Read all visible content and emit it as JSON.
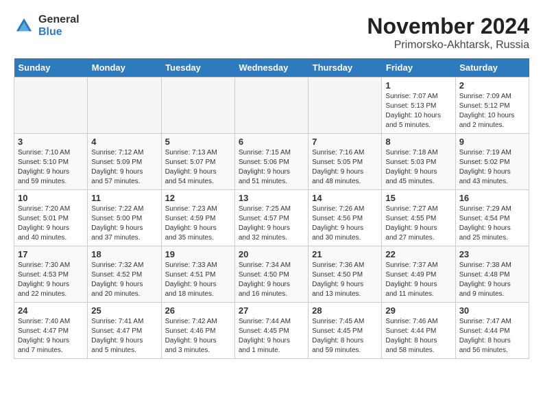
{
  "logo": {
    "general": "General",
    "blue": "Blue"
  },
  "header": {
    "month": "November 2024",
    "location": "Primorsko-Akhtarsk, Russia"
  },
  "weekdays": [
    "Sunday",
    "Monday",
    "Tuesday",
    "Wednesday",
    "Thursday",
    "Friday",
    "Saturday"
  ],
  "weeks": [
    [
      {
        "day": "",
        "info": ""
      },
      {
        "day": "",
        "info": ""
      },
      {
        "day": "",
        "info": ""
      },
      {
        "day": "",
        "info": ""
      },
      {
        "day": "",
        "info": ""
      },
      {
        "day": "1",
        "info": "Sunrise: 7:07 AM\nSunset: 5:13 PM\nDaylight: 10 hours\nand 5 minutes."
      },
      {
        "day": "2",
        "info": "Sunrise: 7:09 AM\nSunset: 5:12 PM\nDaylight: 10 hours\nand 2 minutes."
      }
    ],
    [
      {
        "day": "3",
        "info": "Sunrise: 7:10 AM\nSunset: 5:10 PM\nDaylight: 9 hours\nand 59 minutes."
      },
      {
        "day": "4",
        "info": "Sunrise: 7:12 AM\nSunset: 5:09 PM\nDaylight: 9 hours\nand 57 minutes."
      },
      {
        "day": "5",
        "info": "Sunrise: 7:13 AM\nSunset: 5:07 PM\nDaylight: 9 hours\nand 54 minutes."
      },
      {
        "day": "6",
        "info": "Sunrise: 7:15 AM\nSunset: 5:06 PM\nDaylight: 9 hours\nand 51 minutes."
      },
      {
        "day": "7",
        "info": "Sunrise: 7:16 AM\nSunset: 5:05 PM\nDaylight: 9 hours\nand 48 minutes."
      },
      {
        "day": "8",
        "info": "Sunrise: 7:18 AM\nSunset: 5:03 PM\nDaylight: 9 hours\nand 45 minutes."
      },
      {
        "day": "9",
        "info": "Sunrise: 7:19 AM\nSunset: 5:02 PM\nDaylight: 9 hours\nand 43 minutes."
      }
    ],
    [
      {
        "day": "10",
        "info": "Sunrise: 7:20 AM\nSunset: 5:01 PM\nDaylight: 9 hours\nand 40 minutes."
      },
      {
        "day": "11",
        "info": "Sunrise: 7:22 AM\nSunset: 5:00 PM\nDaylight: 9 hours\nand 37 minutes."
      },
      {
        "day": "12",
        "info": "Sunrise: 7:23 AM\nSunset: 4:59 PM\nDaylight: 9 hours\nand 35 minutes."
      },
      {
        "day": "13",
        "info": "Sunrise: 7:25 AM\nSunset: 4:57 PM\nDaylight: 9 hours\nand 32 minutes."
      },
      {
        "day": "14",
        "info": "Sunrise: 7:26 AM\nSunset: 4:56 PM\nDaylight: 9 hours\nand 30 minutes."
      },
      {
        "day": "15",
        "info": "Sunrise: 7:27 AM\nSunset: 4:55 PM\nDaylight: 9 hours\nand 27 minutes."
      },
      {
        "day": "16",
        "info": "Sunrise: 7:29 AM\nSunset: 4:54 PM\nDaylight: 9 hours\nand 25 minutes."
      }
    ],
    [
      {
        "day": "17",
        "info": "Sunrise: 7:30 AM\nSunset: 4:53 PM\nDaylight: 9 hours\nand 22 minutes."
      },
      {
        "day": "18",
        "info": "Sunrise: 7:32 AM\nSunset: 4:52 PM\nDaylight: 9 hours\nand 20 minutes."
      },
      {
        "day": "19",
        "info": "Sunrise: 7:33 AM\nSunset: 4:51 PM\nDaylight: 9 hours\nand 18 minutes."
      },
      {
        "day": "20",
        "info": "Sunrise: 7:34 AM\nSunset: 4:50 PM\nDaylight: 9 hours\nand 16 minutes."
      },
      {
        "day": "21",
        "info": "Sunrise: 7:36 AM\nSunset: 4:50 PM\nDaylight: 9 hours\nand 13 minutes."
      },
      {
        "day": "22",
        "info": "Sunrise: 7:37 AM\nSunset: 4:49 PM\nDaylight: 9 hours\nand 11 minutes."
      },
      {
        "day": "23",
        "info": "Sunrise: 7:38 AM\nSunset: 4:48 PM\nDaylight: 9 hours\nand 9 minutes."
      }
    ],
    [
      {
        "day": "24",
        "info": "Sunrise: 7:40 AM\nSunset: 4:47 PM\nDaylight: 9 hours\nand 7 minutes."
      },
      {
        "day": "25",
        "info": "Sunrise: 7:41 AM\nSunset: 4:47 PM\nDaylight: 9 hours\nand 5 minutes."
      },
      {
        "day": "26",
        "info": "Sunrise: 7:42 AM\nSunset: 4:46 PM\nDaylight: 9 hours\nand 3 minutes."
      },
      {
        "day": "27",
        "info": "Sunrise: 7:44 AM\nSunset: 4:45 PM\nDaylight: 9 hours\nand 1 minute."
      },
      {
        "day": "28",
        "info": "Sunrise: 7:45 AM\nSunset: 4:45 PM\nDaylight: 8 hours\nand 59 minutes."
      },
      {
        "day": "29",
        "info": "Sunrise: 7:46 AM\nSunset: 4:44 PM\nDaylight: 8 hours\nand 58 minutes."
      },
      {
        "day": "30",
        "info": "Sunrise: 7:47 AM\nSunset: 4:44 PM\nDaylight: 8 hours\nand 56 minutes."
      }
    ]
  ]
}
